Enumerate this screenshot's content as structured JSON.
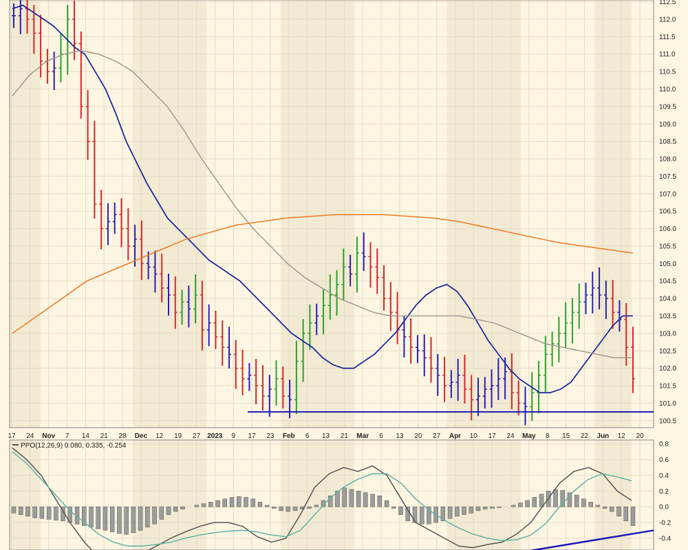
{
  "colors": {
    "background": "#fdf6e3",
    "band": "#f2ead2",
    "grid": "#e4dcc4",
    "bar_up": "#2ca02c",
    "bar_down": "#d62728",
    "bar_neutral": "#2b1fb0",
    "ma_short": "#1f2a9e",
    "ma_mid": "#a09a90",
    "ma_long": "#f07a24",
    "support": "#1a1ab8",
    "ppo": "#555555",
    "signal": "#5fb3a8",
    "hist": "#9c9c9c",
    "trend": "#1a1ab8"
  },
  "chart_data": [
    {
      "type": "ohlc",
      "x_ticks": [
        {
          "label": "17"
        },
        {
          "label": "24"
        },
        {
          "label": "Nov",
          "bold": true
        },
        {
          "label": "7"
        },
        {
          "label": "14"
        },
        {
          "label": "21"
        },
        {
          "label": "28"
        },
        {
          "label": "Dec",
          "bold": true
        },
        {
          "label": "12"
        },
        {
          "label": "19"
        },
        {
          "label": "27"
        },
        {
          "label": "2023",
          "bold": true
        },
        {
          "label": "9"
        },
        {
          "label": "17"
        },
        {
          "label": "23"
        },
        {
          "label": "Feb",
          "bold": true
        },
        {
          "label": "6"
        },
        {
          "label": "13"
        },
        {
          "label": "21"
        },
        {
          "label": "Mar",
          "bold": true
        },
        {
          "label": "6"
        },
        {
          "label": "13"
        },
        {
          "label": "20"
        },
        {
          "label": "27"
        },
        {
          "label": "Apr",
          "bold": true
        },
        {
          "label": "10"
        },
        {
          "label": "17"
        },
        {
          "label": "24"
        },
        {
          "label": "May",
          "bold": true
        },
        {
          "label": "8"
        },
        {
          "label": "15"
        },
        {
          "label": "22"
        },
        {
          "label": "Jun",
          "bold": true
        },
        {
          "label": "12"
        },
        {
          "label": "20"
        }
      ],
      "y_ticks": [
        "112.5",
        "112.0",
        "111.5",
        "111.0",
        "110.5",
        "110.0",
        "109.5",
        "109.0",
        "108.5",
        "108.0",
        "107.5",
        "107.0",
        "106.5",
        "106.0",
        "105.5",
        "105.0",
        "104.5",
        "104.0",
        "103.5",
        "103.0",
        "102.5",
        "102.0",
        "101.5",
        "101.0",
        "100.5"
      ],
      "ylim": [
        100.3,
        112.55
      ],
      "grid": true,
      "support_line": 100.75,
      "closes": [
        112.1,
        112.3,
        112.0,
        111.6,
        110.8,
        110.5,
        110.6,
        111.0,
        112.0,
        111.3,
        109.5,
        108.5,
        106.7,
        106.0,
        106.2,
        106.4,
        106.0,
        105.5,
        105.7,
        105.0,
        104.9,
        104.7,
        104.3,
        104.1,
        103.6,
        103.9,
        103.7,
        104.1,
        103.1,
        103.3,
        102.9,
        102.6,
        102.4,
        102.0,
        101.7,
        101.8,
        101.5,
        101.2,
        101.4,
        101.7,
        101.2,
        101.1,
        102.2,
        103.0,
        103.3,
        103.5,
        103.8,
        104.1,
        104.4,
        104.9,
        104.7,
        105.3,
        105.2,
        104.9,
        104.6,
        104.0,
        103.6,
        103.1,
        102.9,
        102.6,
        102.5,
        102.3,
        102.0,
        101.8,
        101.5,
        101.6,
        101.8,
        101.4,
        101.1,
        101.2,
        101.4,
        101.5,
        101.7,
        101.9,
        101.3,
        101.0,
        100.9,
        101.3,
        101.8,
        102.4,
        102.7,
        103.0,
        103.3,
        103.6,
        103.9,
        104.1,
        104.3,
        104.1,
        104.0,
        103.6,
        103.4,
        102.6,
        101.7
      ],
      "series": [
        {
          "name": "",
          "kind": "ma_short",
          "values": [
            112.3,
            112.4,
            112.2,
            112.0,
            111.8,
            111.5,
            111.2,
            111.0,
            110.5,
            110.0,
            109.3,
            108.5,
            107.9,
            107.3,
            106.8,
            106.3,
            106.0,
            105.7,
            105.4,
            105.1,
            104.9,
            104.7,
            104.5,
            104.2,
            103.9,
            103.6,
            103.3,
            103.0,
            102.8,
            102.6,
            102.3,
            102.1,
            102.0,
            102.0,
            102.2,
            102.4,
            102.7,
            103.0,
            103.4,
            103.8,
            104.1,
            104.3,
            104.4,
            104.2,
            103.8,
            103.3,
            102.8,
            102.4,
            102.0,
            101.7,
            101.5,
            101.3,
            101.3,
            101.4,
            101.6,
            102.0,
            102.4,
            102.8,
            103.2,
            103.5,
            103.5
          ]
        },
        {
          "name": "",
          "kind": "ma_mid",
          "values": [
            109.8,
            110.4,
            110.8,
            111.0,
            111.1,
            111.0,
            110.8,
            110.5,
            110.0,
            109.5,
            108.8,
            108.0,
            107.3,
            106.6,
            106.0,
            105.5,
            105.0,
            104.6,
            104.3,
            104.0,
            103.8,
            103.6,
            103.5,
            103.5,
            103.5,
            103.5,
            103.5,
            103.4,
            103.3,
            103.1,
            102.9,
            102.7,
            102.6,
            102.5,
            102.4,
            102.3,
            102.3
          ]
        },
        {
          "name": "",
          "kind": "ma_long",
          "values": [
            103.0,
            103.5,
            104.0,
            104.5,
            104.8,
            105.1,
            105.4,
            105.7,
            105.9,
            106.1,
            106.2,
            106.3,
            106.35,
            106.4,
            106.4,
            106.4,
            106.35,
            106.3,
            106.2,
            106.05,
            105.9,
            105.75,
            105.6,
            105.5,
            105.4,
            105.3
          ]
        }
      ],
      "period_bars": 94
    },
    {
      "type": "bar",
      "legend": "PPO(12,26,9) 0.080, 0.335, -0.254",
      "y_ticks": [
        "0.8",
        "0.6",
        "0.4",
        "0.2",
        "0.0",
        "-0.2",
        "-0.4"
      ],
      "ylim": [
        -0.55,
        0.85
      ],
      "grid": true,
      "histogram": [
        -0.08,
        -0.1,
        -0.12,
        -0.14,
        -0.15,
        -0.16,
        -0.17,
        -0.18,
        -0.2,
        -0.22,
        -0.24,
        -0.26,
        -0.28,
        -0.3,
        -0.32,
        -0.34,
        -0.35,
        -0.33,
        -0.3,
        -0.26,
        -0.22,
        -0.16,
        -0.1,
        -0.06,
        -0.03,
        0.0,
        0.02,
        0.04,
        0.06,
        0.08,
        0.1,
        0.12,
        0.13,
        0.12,
        0.1,
        0.06,
        0.02,
        -0.02,
        -0.05,
        -0.06,
        -0.05,
        -0.03,
        -0.02,
        0.02,
        0.08,
        0.14,
        0.2,
        0.24,
        0.22,
        0.2,
        0.18,
        0.16,
        0.14,
        0.08,
        -0.02,
        -0.1,
        -0.18,
        -0.2,
        -0.22,
        -0.22,
        -0.2,
        -0.18,
        -0.15,
        -0.12,
        -0.1,
        -0.08,
        -0.05,
        -0.03,
        -0.02,
        -0.01,
        0.0,
        0.02,
        0.05,
        0.08,
        0.12,
        0.16,
        0.2,
        0.22,
        0.21,
        0.18,
        0.15,
        0.1,
        0.06,
        0.02,
        -0.02,
        -0.06,
        -0.12,
        -0.18,
        -0.24
      ],
      "series": [
        {
          "name": "",
          "kind": "ppo",
          "values": [
            0.75,
            0.6,
            0.4,
            0.1,
            -0.2,
            -0.45,
            -0.65,
            -0.75,
            -0.7,
            -0.6,
            -0.5,
            -0.4,
            -0.32,
            -0.25,
            -0.2,
            -0.2,
            -0.25,
            -0.38,
            -0.45,
            -0.4,
            -0.1,
            0.25,
            0.42,
            0.5,
            0.45,
            0.52,
            0.4,
            0.1,
            -0.2,
            -0.3,
            -0.4,
            -0.5,
            -0.52,
            -0.48,
            -0.45,
            -0.35,
            -0.2,
            0.05,
            0.3,
            0.45,
            0.5,
            0.42,
            0.2,
            0.08
          ]
        },
        {
          "name": "",
          "kind": "signal",
          "values": [
            0.7,
            0.55,
            0.35,
            0.15,
            -0.05,
            -0.2,
            -0.35,
            -0.45,
            -0.5,
            -0.5,
            -0.48,
            -0.45,
            -0.4,
            -0.36,
            -0.33,
            -0.31,
            -0.3,
            -0.32,
            -0.36,
            -0.38,
            -0.3,
            -0.1,
            0.1,
            0.25,
            0.35,
            0.42,
            0.42,
            0.3,
            0.1,
            -0.05,
            -0.17,
            -0.27,
            -0.35,
            -0.4,
            -0.43,
            -0.42,
            -0.36,
            -0.22,
            0.0,
            0.2,
            0.35,
            0.42,
            0.38,
            0.33
          ]
        }
      ],
      "trend_line": [
        -0.61,
        -0.3
      ]
    }
  ]
}
